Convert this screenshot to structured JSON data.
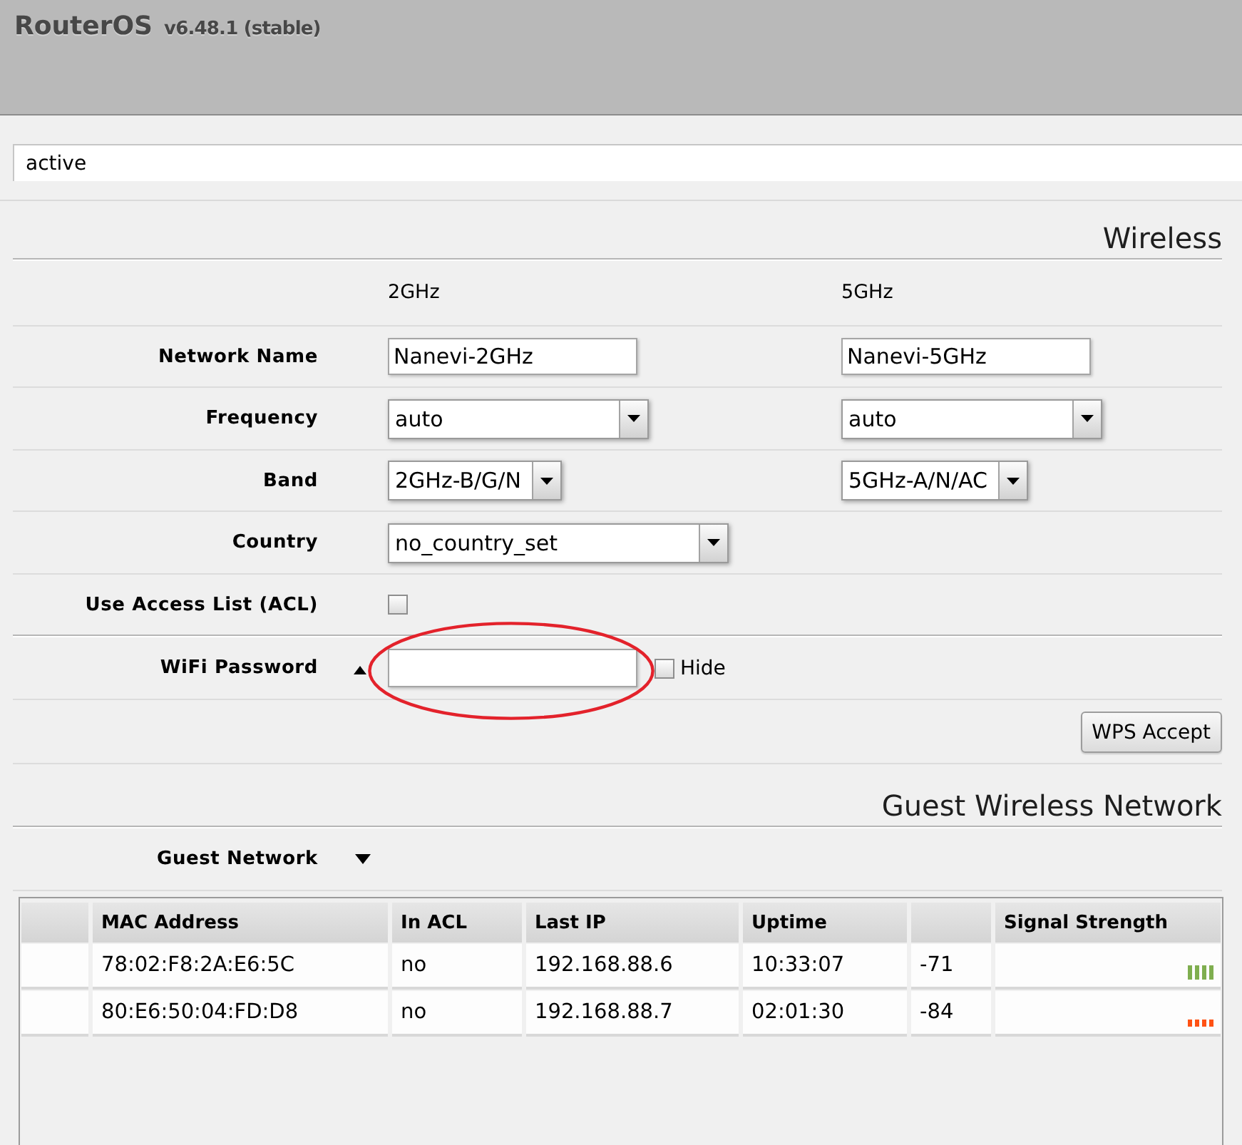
{
  "header": {
    "title": "RouterOS",
    "version": "v6.48.1 (stable)"
  },
  "status": {
    "value": "active"
  },
  "wireless": {
    "title": "Wireless",
    "bands": [
      "2GHz",
      "5GHz"
    ],
    "fields": [
      {
        "kind": "text",
        "label": "Network Name",
        "values": [
          "Nanevi-2GHz",
          "Nanevi-5GHz"
        ]
      },
      {
        "kind": "select",
        "label": "Frequency",
        "values": [
          "auto",
          "auto"
        ]
      },
      {
        "kind": "select",
        "label": "Band",
        "values": [
          "2GHz-B/G/N",
          "5GHz-A/N/AC"
        ]
      },
      {
        "kind": "select",
        "label": "Country",
        "values": [
          "no_country_set"
        ]
      },
      {
        "kind": "checkbox",
        "label": "Use Access List (ACL)",
        "checked": false
      }
    ],
    "wifi_password": {
      "label": "WiFi Password",
      "hide_label": "Hide",
      "hide_checked": false,
      "highlighted": true
    },
    "wps_button": "WPS Accept"
  },
  "guest": {
    "title": "Guest Wireless Network",
    "network_label": "Guest Network",
    "table": {
      "columns": [
        "",
        "MAC Address",
        "In ACL",
        "Last IP",
        "Uptime",
        "",
        "Signal Strength"
      ],
      "rows": [
        {
          "cells": [
            "",
            "78:02:F8:2A:E6:5C",
            "no",
            "192.168.88.6",
            "10:33:07",
            "-71",
            ""
          ],
          "kind": "strong",
          "color": "#7fae4f"
        },
        {
          "cells": [
            "",
            "80:E6:50:04:FD:D8",
            "no",
            "192.168.88.7",
            "02:01:30",
            "-84",
            ""
          ],
          "kind": "weak",
          "color": "#ff5214"
        }
      ]
    }
  }
}
